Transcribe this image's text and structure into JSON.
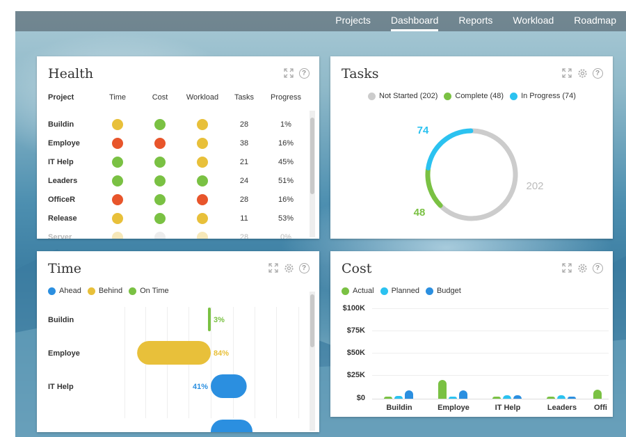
{
  "nav": {
    "items": [
      "Projects",
      "Dashboard",
      "Reports",
      "Workload",
      "Roadmap"
    ],
    "active": "Dashboard"
  },
  "colors": {
    "red": "#e8552b",
    "yellow": "#e8c03a",
    "green": "#7ac143",
    "blue": "#2b8fe0",
    "cyan": "#2bc2f0",
    "gray": "#cccccc"
  },
  "health": {
    "title": "Health",
    "columns": [
      "Project",
      "Time",
      "Cost",
      "Workload",
      "Tasks",
      "Progress"
    ],
    "rows": [
      {
        "project": "Buildin",
        "time": "yellow",
        "cost": "green",
        "workload": "yellow",
        "tasks": "28",
        "progress": "1%"
      },
      {
        "project": "Employe",
        "time": "red",
        "cost": "red",
        "workload": "yellow",
        "tasks": "38",
        "progress": "16%"
      },
      {
        "project": "IT Help",
        "time": "green",
        "cost": "green",
        "workload": "yellow",
        "tasks": "21",
        "progress": "45%"
      },
      {
        "project": "Leaders",
        "time": "green",
        "cost": "green",
        "workload": "green",
        "tasks": "24",
        "progress": "51%"
      },
      {
        "project": "OfficeR",
        "time": "red",
        "cost": "green",
        "workload": "red",
        "tasks": "28",
        "progress": "16%"
      },
      {
        "project": "Release",
        "time": "yellow",
        "cost": "green",
        "workload": "yellow",
        "tasks": "11",
        "progress": "53%"
      },
      {
        "project": "Server",
        "time": "yellow",
        "cost": "gray",
        "workload": "yellow",
        "tasks": "28",
        "progress": "0%"
      }
    ]
  },
  "tasks": {
    "title": "Tasks",
    "legend": [
      "Not Started (202)",
      "Complete (48)",
      "In Progress (74)"
    ],
    "labels": {
      "in_progress": "74",
      "complete": "48",
      "not_started": "202"
    },
    "chart_data": {
      "type": "pie",
      "categories": [
        "Not Started",
        "Complete",
        "In Progress"
      ],
      "values": [
        202,
        48,
        74
      ]
    }
  },
  "time": {
    "title": "Time",
    "legend": [
      "Ahead",
      "Behind",
      "On Time"
    ],
    "rows": [
      {
        "project": "Buildin",
        "status": "On Time",
        "pct": 3,
        "label": "3%"
      },
      {
        "project": "Employe",
        "status": "Behind",
        "pct": 84,
        "label": "84%"
      },
      {
        "project": "IT Help",
        "status": "Ahead",
        "pct": 41,
        "label": "41%"
      }
    ]
  },
  "cost": {
    "title": "Cost",
    "legend": [
      "Actual",
      "Planned",
      "Budget"
    ],
    "yticks": [
      "$100K",
      "$75K",
      "$50K",
      "$25K",
      "$0"
    ],
    "xticks": [
      "Buildin",
      "Employe",
      "IT Help",
      "Leaders",
      "Offi"
    ],
    "chart_data": {
      "type": "bar",
      "categories": [
        "Buildin",
        "Employe",
        "IT Help",
        "Leaders",
        "Offi"
      ],
      "ylim": [
        0,
        100000
      ],
      "series": [
        {
          "name": "Actual",
          "values": [
            1000,
            21000,
            1000,
            1000,
            10000
          ]
        },
        {
          "name": "Planned",
          "values": [
            3000,
            1000,
            4000,
            4000,
            0
          ]
        },
        {
          "name": "Budget",
          "values": [
            9000,
            9000,
            4000,
            2000,
            0
          ]
        }
      ]
    }
  }
}
